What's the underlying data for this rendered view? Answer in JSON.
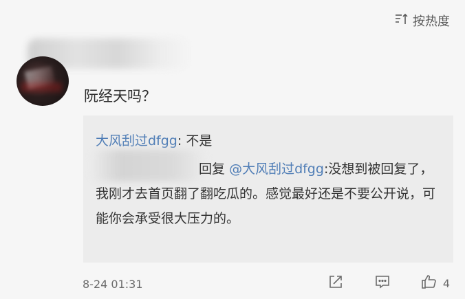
{
  "header": {
    "sort_label": "按热度"
  },
  "comment": {
    "text": "阮经天吗？",
    "time": "8-24 01:31",
    "likes": "4"
  },
  "replies": [
    {
      "user": "大风刮过dfgg",
      "sep": ": ",
      "text": "不是"
    },
    {
      "reply_word": "回复",
      "mention": "@大风刮过dfgg",
      "text": ":没想到被回复了，我刚才去首页翻了翻吃瓜的。感觉最好还是不要公开说，可能你会承受很大压力的。"
    }
  ],
  "icons": {
    "sort": "sort-icon",
    "share": "share-icon",
    "comment": "comment-icon",
    "like": "thumbs-up-icon"
  },
  "colors": {
    "link": "#4f7db6",
    "text": "#333333",
    "muted": "#6a6a6a",
    "reply_bg": "#ececec"
  }
}
